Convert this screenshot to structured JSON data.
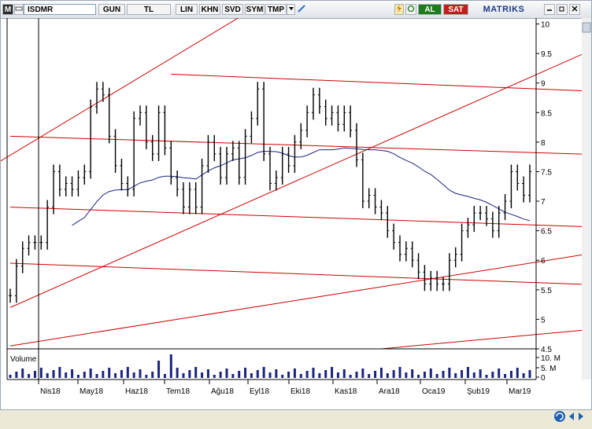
{
  "toolbar": {
    "menu_label": "M",
    "symbol": "ISDMR",
    "period": "GUN",
    "currency": "TL",
    "scale": "LIN",
    "khn_label": "KHN",
    "svd_label": "SVD",
    "sym_label": "SYM",
    "tmp_label": "TMP",
    "buy_label": "AL",
    "sell_label": "SAT",
    "brand": "MATRIKS"
  },
  "chart_data": {
    "type": "candlestick",
    "symbol": "ISDMR",
    "price_axis": {
      "ticks": [
        "10",
        "9.5",
        "9",
        "8.5",
        "8",
        "7.5",
        "7",
        "6.5",
        "6",
        "5.5",
        "5",
        "4.5"
      ],
      "ylim": [
        4.5,
        10.1
      ]
    },
    "volume_axis": {
      "label": "Volume",
      "ticks": [
        "10. M",
        "5. M",
        "0"
      ]
    },
    "x_axis": {
      "ticks": [
        "Nis18",
        "May18",
        "Haz18",
        "Tem18",
        "Ağu18",
        "Eyl18",
        "Eki18",
        "Kas18",
        "Ara18",
        "Oca19",
        "Şub19",
        "Mar19"
      ]
    },
    "colors": {
      "price": "#000000",
      "moving_average": "#1a237e",
      "channels": "#cc0000",
      "volume": "#1a237e"
    },
    "price_series_approx": [
      [
        0,
        5.4
      ],
      [
        2,
        5.9
      ],
      [
        4,
        6.2
      ],
      [
        6,
        6.3
      ],
      [
        8,
        6.3
      ],
      [
        10,
        6.3
      ],
      [
        12,
        6.9
      ],
      [
        14,
        7.5
      ],
      [
        16,
        7.2
      ],
      [
        18,
        7.3
      ],
      [
        20,
        7.2
      ],
      [
        22,
        7.4
      ],
      [
        24,
        7.5
      ],
      [
        26,
        8.6
      ],
      [
        28,
        8.9
      ],
      [
        30,
        8.8
      ],
      [
        32,
        8.1
      ],
      [
        34,
        7.6
      ],
      [
        36,
        7.3
      ],
      [
        38,
        7.2
      ],
      [
        40,
        8.4
      ],
      [
        42,
        8.5
      ],
      [
        44,
        8.0
      ],
      [
        46,
        7.8
      ],
      [
        48,
        8.5
      ],
      [
        50,
        7.9
      ],
      [
        52,
        7.4
      ],
      [
        54,
        7.2
      ],
      [
        56,
        6.9
      ],
      [
        58,
        7.2
      ],
      [
        60,
        6.9
      ],
      [
        62,
        7.6
      ],
      [
        64,
        8.0
      ],
      [
        66,
        7.8
      ],
      [
        68,
        7.4
      ],
      [
        70,
        7.8
      ],
      [
        72,
        7.9
      ],
      [
        74,
        7.4
      ],
      [
        76,
        8.1
      ],
      [
        78,
        8.4
      ],
      [
        80,
        8.9
      ],
      [
        82,
        7.8
      ],
      [
        84,
        7.3
      ],
      [
        86,
        7.4
      ],
      [
        88,
        7.8
      ],
      [
        90,
        7.6
      ],
      [
        92,
        8.0
      ],
      [
        94,
        8.2
      ],
      [
        96,
        8.5
      ],
      [
        98,
        8.8
      ],
      [
        100,
        8.6
      ],
      [
        102,
        8.4
      ],
      [
        104,
        8.5
      ],
      [
        106,
        8.3
      ],
      [
        108,
        8.5
      ],
      [
        110,
        8.2
      ],
      [
        112,
        7.7
      ],
      [
        114,
        7.0
      ],
      [
        116,
        7.1
      ],
      [
        118,
        6.9
      ],
      [
        120,
        6.8
      ],
      [
        122,
        6.5
      ],
      [
        124,
        6.3
      ],
      [
        126,
        6.1
      ],
      [
        128,
        6.2
      ],
      [
        130,
        6.0
      ],
      [
        132,
        5.8
      ],
      [
        134,
        5.6
      ],
      [
        136,
        5.7
      ],
      [
        138,
        5.6
      ],
      [
        140,
        5.6
      ],
      [
        142,
        6.0
      ],
      [
        144,
        6.1
      ],
      [
        146,
        6.5
      ],
      [
        148,
        6.6
      ],
      [
        150,
        6.8
      ],
      [
        152,
        6.8
      ],
      [
        154,
        6.7
      ],
      [
        156,
        6.5
      ],
      [
        158,
        6.8
      ],
      [
        160,
        7.0
      ],
      [
        162,
        7.5
      ],
      [
        164,
        7.3
      ],
      [
        166,
        7.1
      ],
      [
        168,
        7.5
      ]
    ]
  }
}
